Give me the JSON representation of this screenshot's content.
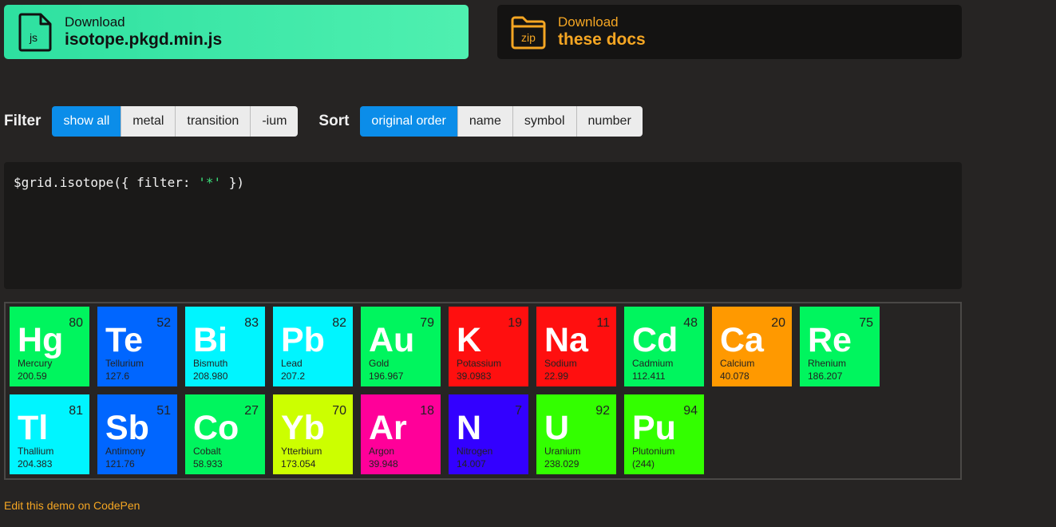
{
  "downloads": {
    "js": {
      "icon_text": "js",
      "small": "Download",
      "big": "isotope.pkgd.min.js",
      "color": "#2ee0a0"
    },
    "zip": {
      "icon_text": "zip",
      "small": "Download",
      "big": "these docs",
      "color": "#f5a623"
    }
  },
  "filter": {
    "label": "Filter",
    "buttons": [
      "show all",
      "metal",
      "transition",
      "-ium"
    ],
    "active": "show all"
  },
  "sort": {
    "label": "Sort",
    "buttons": [
      "original order",
      "name",
      "symbol",
      "number"
    ],
    "active": "original order"
  },
  "code": {
    "prefix": "$grid.isotope({ filter: ",
    "string": "'*'",
    "suffix": " })"
  },
  "elements": [
    {
      "symbol": "Hg",
      "name": "Mercury",
      "number": "80",
      "weight": "200.59",
      "color": "#00f55e"
    },
    {
      "symbol": "Te",
      "name": "Tellurium",
      "number": "52",
      "weight": "127.6",
      "color": "#0066ff"
    },
    {
      "symbol": "Bi",
      "name": "Bismuth",
      "number": "83",
      "weight": "208.980",
      "color": "#00f5ff"
    },
    {
      "symbol": "Pb",
      "name": "Lead",
      "number": "82",
      "weight": "207.2",
      "color": "#00f5ff"
    },
    {
      "symbol": "Au",
      "name": "Gold",
      "number": "79",
      "weight": "196.967",
      "color": "#00f55e"
    },
    {
      "symbol": "K",
      "name": "Potassium",
      "number": "19",
      "weight": "39.0983",
      "color": "#ff0f0f"
    },
    {
      "symbol": "Na",
      "name": "Sodium",
      "number": "11",
      "weight": "22.99",
      "color": "#ff0f0f"
    },
    {
      "symbol": "Cd",
      "name": "Cadmium",
      "number": "48",
      "weight": "112.411",
      "color": "#00f55e"
    },
    {
      "symbol": "Ca",
      "name": "Calcium",
      "number": "20",
      "weight": "40.078",
      "color": "#ff9900"
    },
    {
      "symbol": "Re",
      "name": "Rhenium",
      "number": "75",
      "weight": "186.207",
      "color": "#00f55e"
    },
    {
      "symbol": "Tl",
      "name": "Thallium",
      "number": "81",
      "weight": "204.383",
      "color": "#00f5ff"
    },
    {
      "symbol": "Sb",
      "name": "Antimony",
      "number": "51",
      "weight": "121.76",
      "color": "#0066ff"
    },
    {
      "symbol": "Co",
      "name": "Cobalt",
      "number": "27",
      "weight": "58.933",
      "color": "#00f55e"
    },
    {
      "symbol": "Yb",
      "name": "Ytterbium",
      "number": "70",
      "weight": "173.054",
      "color": "#ccff00"
    },
    {
      "symbol": "Ar",
      "name": "Argon",
      "number": "18",
      "weight": "39.948",
      "color": "#ff0099"
    },
    {
      "symbol": "N",
      "name": "Nitrogen",
      "number": "7",
      "weight": "14.007",
      "color": "#3300ff"
    },
    {
      "symbol": "U",
      "name": "Uranium",
      "number": "92",
      "weight": "238.029",
      "color": "#33ff00"
    },
    {
      "symbol": "Pu",
      "name": "Plutonium",
      "number": "94",
      "weight": "(244)",
      "color": "#33ff00"
    }
  ],
  "footer": {
    "codepen_link": "Edit this demo on CodePen"
  }
}
